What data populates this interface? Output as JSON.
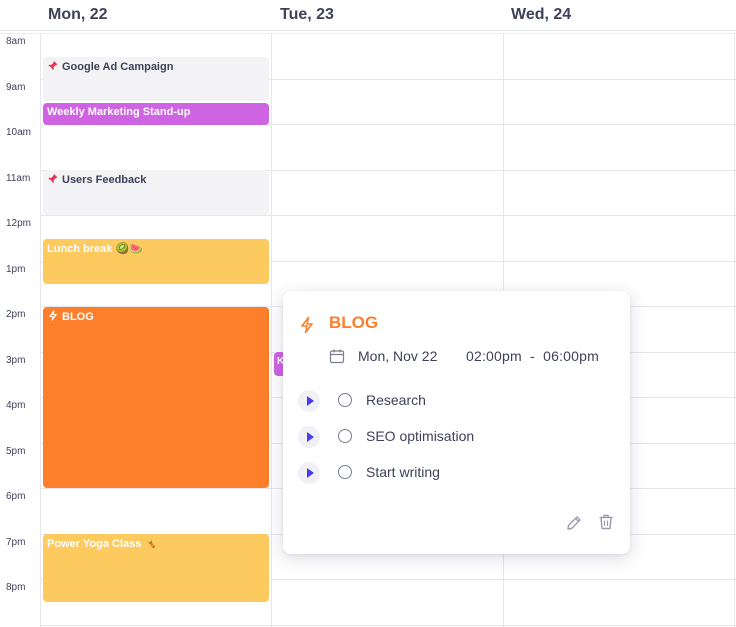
{
  "days": [
    "Mon, 22",
    "Tue, 23",
    "Wed, 24"
  ],
  "hours": [
    "8am",
    "9am",
    "10am",
    "11am",
    "12pm",
    "1pm",
    "2pm",
    "3pm",
    "4pm",
    "5pm",
    "6pm",
    "7pm",
    "8pm"
  ],
  "events": {
    "google_ad": "Google Ad Campaign",
    "standup": "Weekly Marketing Stand-up",
    "feedback": "Users Feedback",
    "lunch": "Lunch break 🥝🍉",
    "blog": "BLOG",
    "yoga": "Power Yoga Class 🤸",
    "peek": "K"
  },
  "popup": {
    "title": "BLOG",
    "date": "Mon, Nov 22",
    "time": "02:00pm  -  06:00pm",
    "tasks": [
      "Research",
      "SEO optimisation",
      "Start writing"
    ]
  },
  "colors": {
    "orange": "#fd7f2c",
    "purple": "#cf64e3",
    "yellow": "#fdca5f",
    "grey": "#f3f3f6",
    "text": "#3f4159",
    "play_accent": "#4b3cf0"
  },
  "icons": [
    "pin-icon",
    "lightning-icon",
    "calendar-icon",
    "play-icon",
    "edit-icon",
    "trash-icon"
  ]
}
